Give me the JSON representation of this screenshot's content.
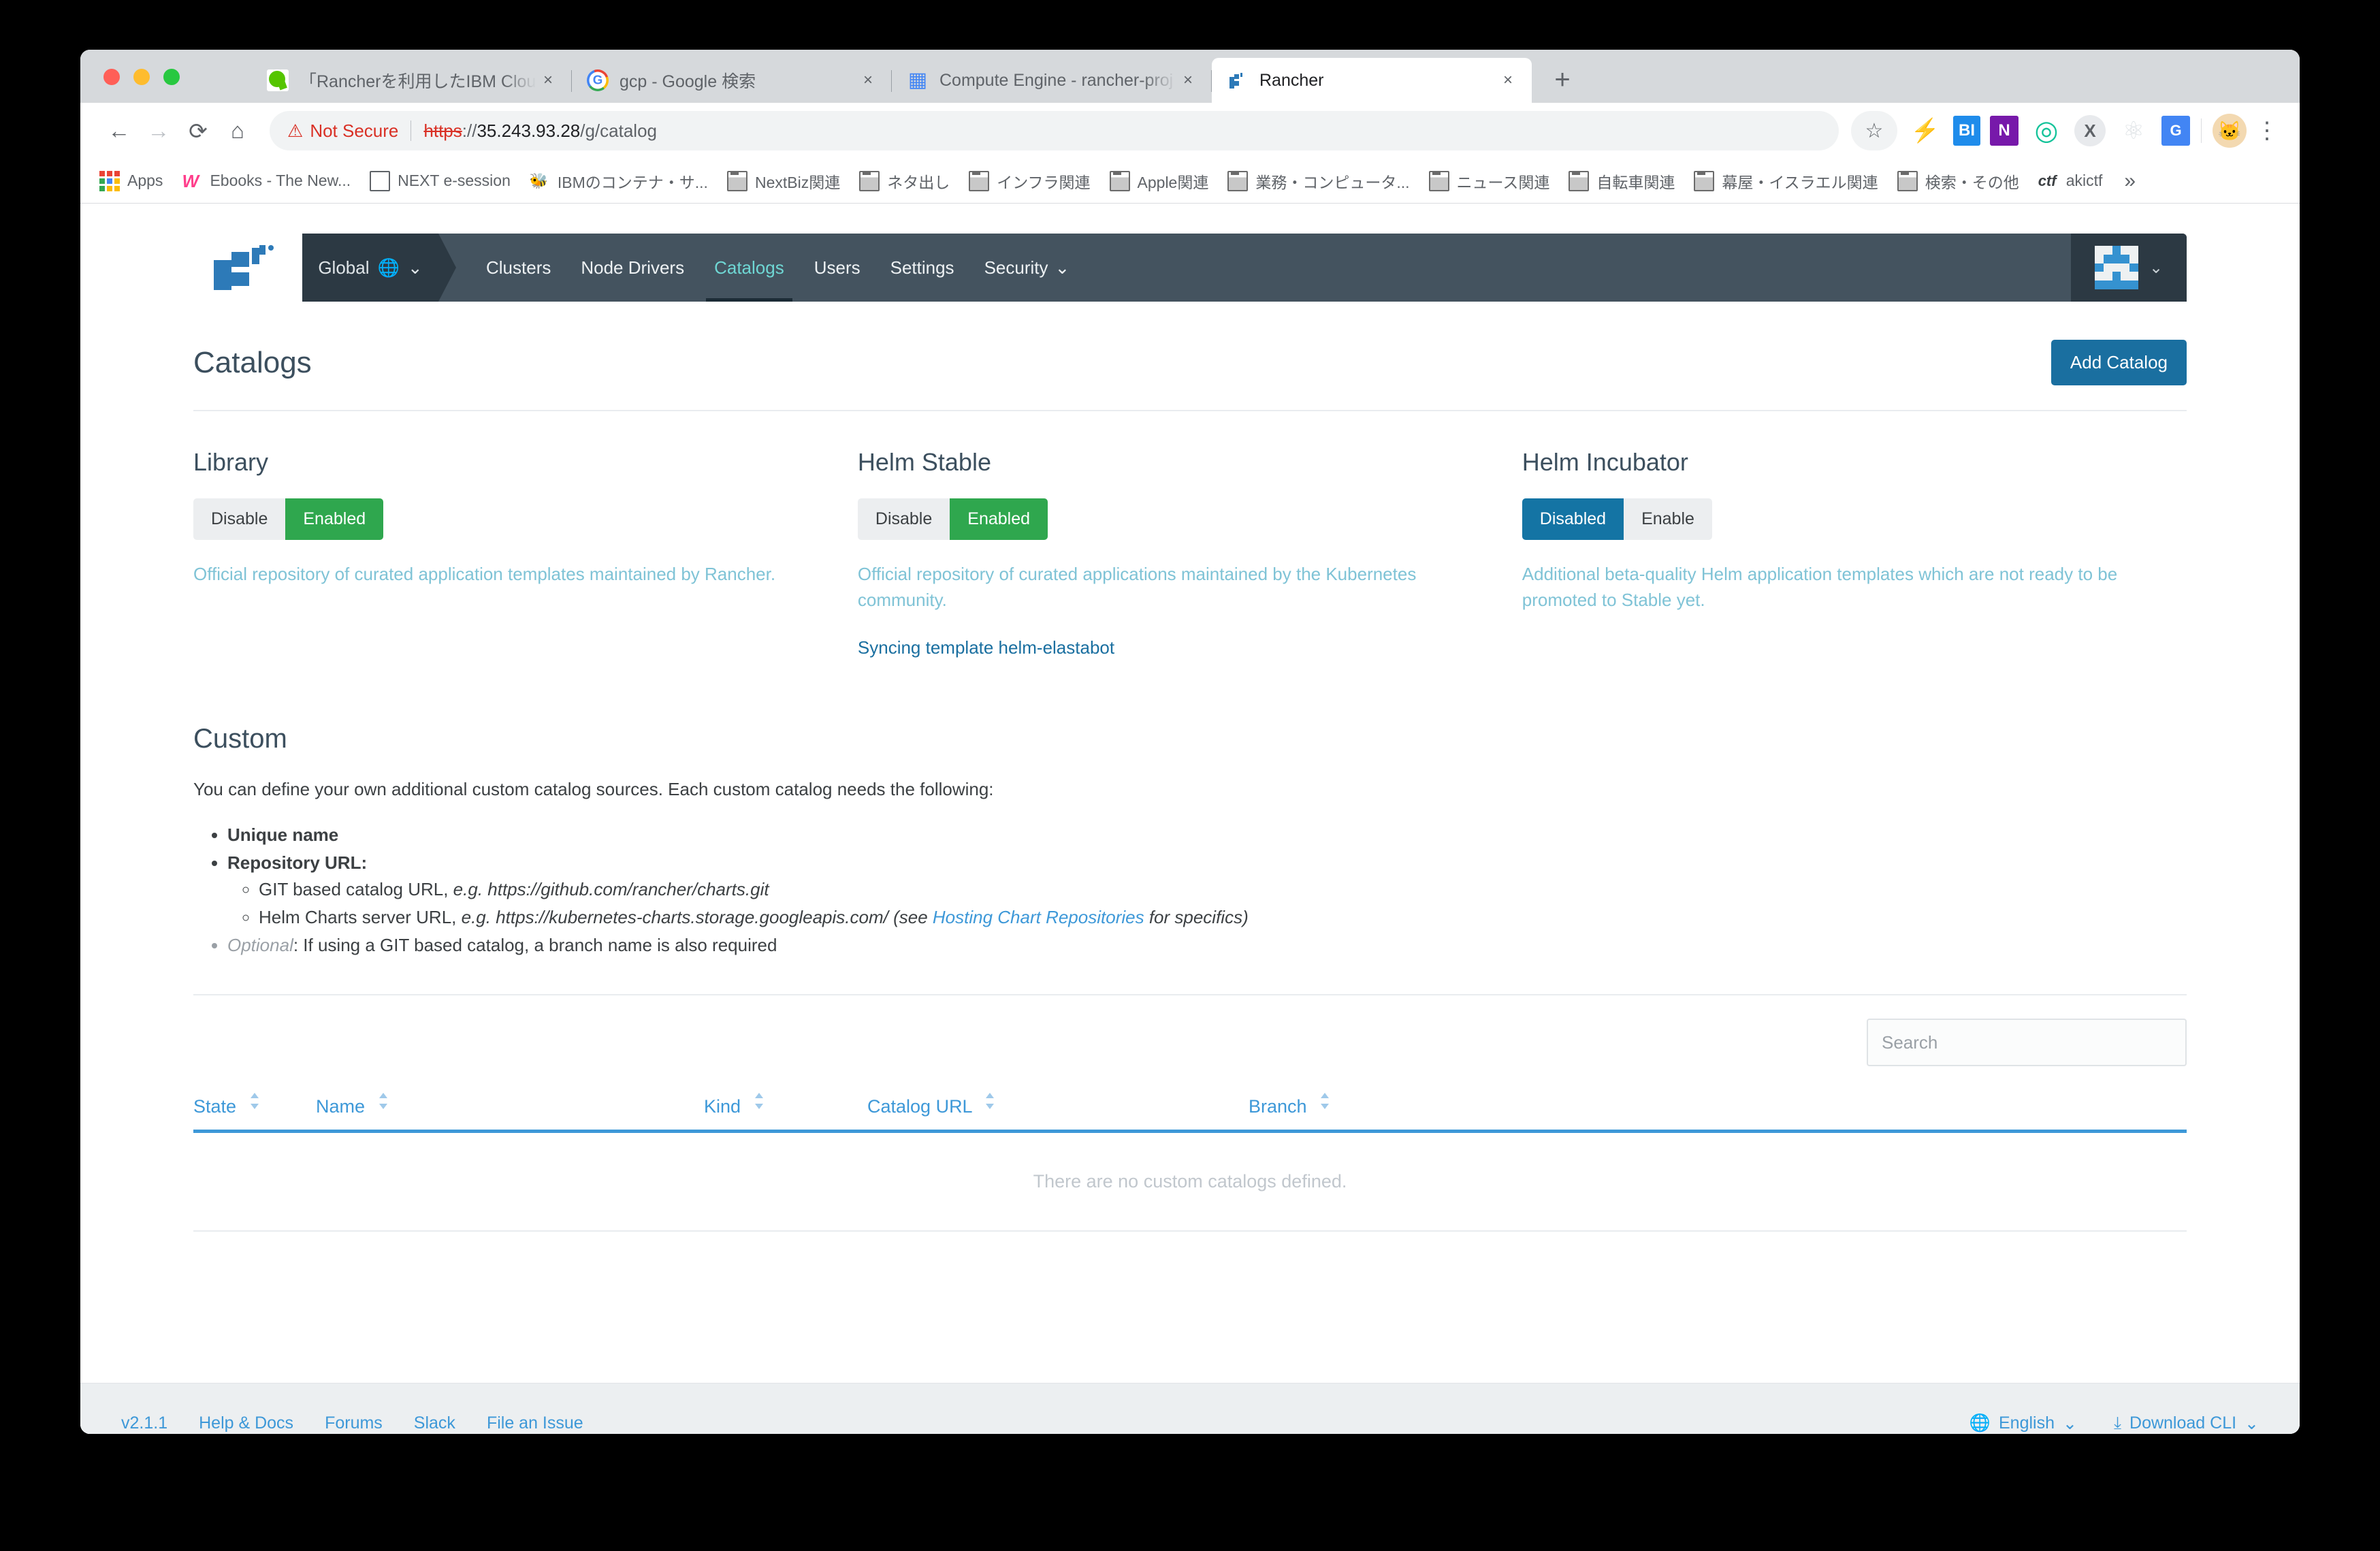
{
  "browser": {
    "tabs": [
      {
        "title": "「Rancherを利用したIBM Cloud",
        "favicon": "qiita-icon",
        "active": false,
        "close_label": "×"
      },
      {
        "title": "gcp - Google 検索",
        "favicon": "google-icon",
        "active": false,
        "close_label": "×"
      },
      {
        "title": "Compute Engine - rancher-proj",
        "favicon": "gcp-compute-icon",
        "active": false,
        "close_label": "×"
      },
      {
        "title": "Rancher",
        "favicon": "rancher-icon",
        "active": true,
        "close_label": "×"
      }
    ],
    "new_tab_label": "+",
    "nav": {
      "back": "←",
      "forward": "→",
      "reload": "⟳",
      "home": "⌂"
    },
    "omnibox": {
      "warning_icon": "warning-triangle-icon",
      "security_label": "Not Secure",
      "scheme": "https",
      "separator": "://",
      "host": "35.243.93.28",
      "path": "/g/catalog",
      "star_label": "☆"
    },
    "extensions": [
      {
        "name": "lightning-icon",
        "glyph": "⚡"
      },
      {
        "name": "power-bi-icon",
        "glyph": "BI"
      },
      {
        "name": "onenote-icon",
        "glyph": "N"
      },
      {
        "name": "grammarly-icon",
        "glyph": "◎"
      },
      {
        "name": "x-extension-icon",
        "glyph": "X"
      },
      {
        "name": "react-devtools-icon",
        "glyph": "⚛"
      },
      {
        "name": "google-translate-icon",
        "glyph": "G"
      }
    ],
    "profile_avatar": "🐱",
    "menu_label": "⋮",
    "bookmarks": [
      {
        "label": "Apps",
        "icon": "apps-grid-icon"
      },
      {
        "label": "Ebooks - The New...",
        "icon": "w-icon"
      },
      {
        "label": "NEXT e-session",
        "icon": "document-icon"
      },
      {
        "label": "IBMのコンテナ・サ...",
        "icon": "bee-icon"
      },
      {
        "label": "NextBiz関連",
        "icon": "folder-icon"
      },
      {
        "label": "ネタ出し",
        "icon": "folder-icon"
      },
      {
        "label": "インフラ関連",
        "icon": "folder-icon"
      },
      {
        "label": "Apple関連",
        "icon": "folder-icon"
      },
      {
        "label": "業務・コンピュータ...",
        "icon": "folder-icon"
      },
      {
        "label": "ニュース関連",
        "icon": "folder-icon"
      },
      {
        "label": "自転車関連",
        "icon": "folder-icon"
      },
      {
        "label": "幕屋・イスラエル関連",
        "icon": "folder-icon"
      },
      {
        "label": "検索・その他",
        "icon": "folder-icon"
      },
      {
        "label": "akictf",
        "icon": "ctf-icon"
      }
    ],
    "bookmarks_overflow": "»"
  },
  "app": {
    "nav": {
      "scope_label": "Global",
      "scope_globe_icon": "globe-icon",
      "scope_chevron": "⌄",
      "links": [
        {
          "label": "Clusters",
          "active": false
        },
        {
          "label": "Node Drivers",
          "active": false
        },
        {
          "label": "Catalogs",
          "active": true
        },
        {
          "label": "Users",
          "active": false
        },
        {
          "label": "Settings",
          "active": false
        },
        {
          "label": "Security",
          "active": false,
          "chevron": "⌄"
        }
      ],
      "user_chevron": "⌄"
    },
    "header": {
      "title": "Catalogs",
      "add_button": "Add Catalog"
    },
    "catalogs": [
      {
        "name": "Library",
        "left_label": "Disable",
        "right_label": "Enabled",
        "active_side": "right",
        "active_color": "green",
        "description": "Official repository of curated application templates maintained by Rancher.",
        "sync_note": ""
      },
      {
        "name": "Helm Stable",
        "left_label": "Disable",
        "right_label": "Enabled",
        "active_side": "right",
        "active_color": "green",
        "description": "Official repository of curated applications maintained by the Kubernetes community.",
        "sync_note": "Syncing template helm-elastabot"
      },
      {
        "name": "Helm Incubator",
        "left_label": "Disabled",
        "right_label": "Enable",
        "active_side": "left",
        "active_color": "blue",
        "description": "Additional beta-quality Helm application templates which are not ready to be promoted to Stable yet.",
        "sync_note": ""
      }
    ],
    "custom": {
      "title": "Custom",
      "lede": "You can define your own additional custom catalog sources. Each custom catalog needs the following:",
      "bullet_unique_name": "Unique name",
      "bullet_repo_url": "Repository URL:",
      "sub_git_prefix": "GIT based catalog URL, ",
      "sub_git_eg": "e.g. https://github.com/rancher/charts.git",
      "sub_helm_prefix": "Helm Charts server URL, ",
      "sub_helm_eg": "e.g. https://kubernetes-charts.storage.googleapis.com/ (see ",
      "sub_helm_link": "Hosting Chart Repositories",
      "sub_helm_suffix": " for specifics)",
      "optional_label": "Optional",
      "optional_text": ": If using a GIT based catalog, a branch name is also required"
    },
    "table": {
      "search_placeholder": "Search",
      "search_value": "",
      "columns": [
        "State",
        "Name",
        "Kind",
        "Catalog URL",
        "Branch"
      ],
      "empty_message": "There are no custom catalogs defined.",
      "rows": []
    },
    "footer": {
      "version": "v2.1.1",
      "links": [
        "Help & Docs",
        "Forums",
        "Slack",
        "File an Issue"
      ],
      "language_icon": "globe-icon",
      "language": "English",
      "language_chevron": "⌄",
      "download_icon": "download-icon",
      "download": "Download CLI",
      "download_chevron": "⌄"
    }
  },
  "colors": {
    "accent_blue": "#1a6fa0",
    "link_blue": "#3d98d8",
    "enabled_green": "#2fa74e",
    "disabled_blue": "#1474a4",
    "nav_bg": "#44535f",
    "nav_dark": "#2c3943",
    "teal_text": "#7fc3d6"
  }
}
